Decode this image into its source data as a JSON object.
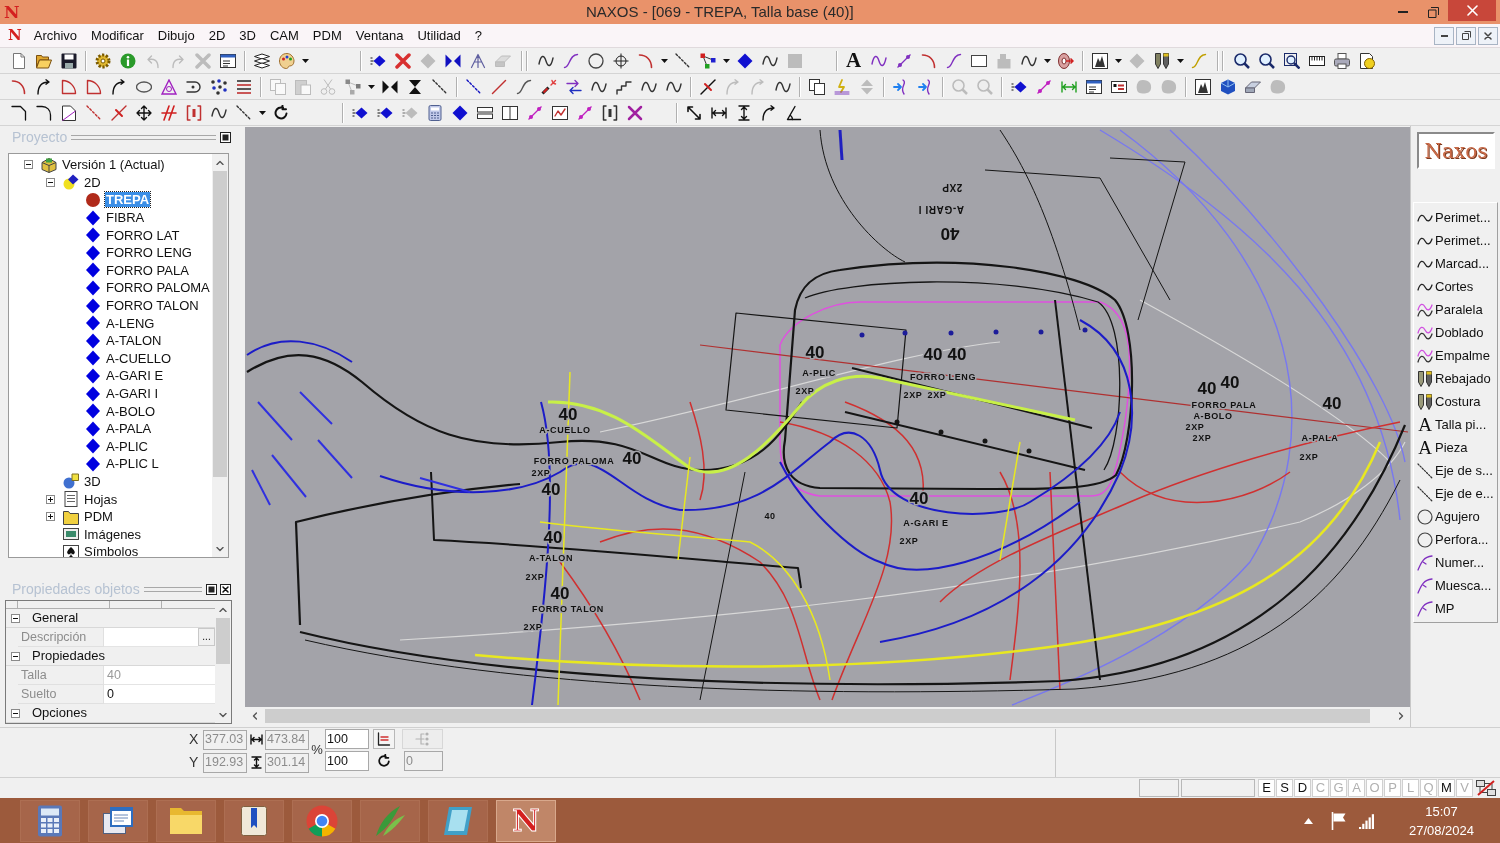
{
  "title_bar": {
    "logo": "N",
    "title": "NAXOS - [069 - TREPA, Talla base (40)]"
  },
  "menu_bar": {
    "logo": "N",
    "items": [
      "Archivo",
      "Modificar",
      "Dibujo",
      "2D",
      "3D",
      "CAM",
      "PDM",
      "Ventana",
      "Utilidad",
      "?"
    ]
  },
  "toolbar": {
    "text_tool": "A"
  },
  "project_panel": {
    "title": "Proyecto",
    "tree": [
      {
        "label": "Versión 1 (Actual)",
        "kind": "version",
        "expanded": true,
        "selected": false,
        "children": [
          {
            "label": "2D",
            "kind": "plane",
            "expanded": true,
            "selected": false,
            "children": [
              {
                "label": "TREPA",
                "kind": "piece",
                "selected": true
              },
              {
                "label": "FIBRA",
                "kind": "piece",
                "selected": false
              },
              {
                "label": "FORRO LAT",
                "kind": "piece",
                "selected": false
              },
              {
                "label": "FORRO LENG",
                "kind": "piece",
                "selected": false
              },
              {
                "label": "FORRO PALA",
                "kind": "piece",
                "selected": false
              },
              {
                "label": "FORRO PALOMA",
                "kind": "piece",
                "selected": false
              },
              {
                "label": "FORRO TALON",
                "kind": "piece",
                "selected": false
              },
              {
                "label": "A-LENG",
                "kind": "piece",
                "selected": false
              },
              {
                "label": "A-TALON",
                "kind": "piece",
                "selected": false
              },
              {
                "label": "A-CUELLO",
                "kind": "piece",
                "selected": false
              },
              {
                "label": "A-GARI E",
                "kind": "piece",
                "selected": false
              },
              {
                "label": "A-GARI I",
                "kind": "piece",
                "selected": false
              },
              {
                "label": "A-BOLO",
                "kind": "piece",
                "selected": false
              },
              {
                "label": "A-PALA",
                "kind": "piece",
                "selected": false
              },
              {
                "label": "A-PLIC",
                "kind": "piece",
                "selected": false
              },
              {
                "label": "A-PLIC L",
                "kind": "piece",
                "selected": false
              }
            ]
          },
          {
            "label": "3D",
            "kind": "solid",
            "selected": false
          },
          {
            "label": "Hojas",
            "kind": "sheets",
            "expanded": false,
            "selected": false
          },
          {
            "label": "PDM",
            "kind": "folder",
            "expanded": false,
            "selected": false
          },
          {
            "label": "Imágenes",
            "kind": "images",
            "selected": false
          },
          {
            "label": "Símbolos",
            "kind": "symbols",
            "selected": false
          }
        ]
      }
    ]
  },
  "properties_panel": {
    "title": "Propiedades objetos",
    "groups": [
      {
        "label": "General",
        "expanded": true,
        "rows": [
          {
            "label": "Descripción",
            "button": "..."
          }
        ]
      },
      {
        "label": "Propiedades",
        "expanded": true,
        "rows": [
          {
            "label": "Talla",
            "value": "40",
            "readonly": true
          },
          {
            "label": "Suelto",
            "value": "0",
            "readonly": false
          }
        ]
      },
      {
        "label": "Opciones",
        "expanded": true
      }
    ]
  },
  "drawing": {
    "labels": [
      {
        "text": "2XP",
        "kind": "flipped_text"
      },
      {
        "text": "A-GARI I",
        "kind": "flipped_text"
      },
      {
        "text": "40",
        "kind": "flipped_size"
      },
      {
        "text": "40",
        "kind": "size"
      },
      {
        "text": "A-PLIC",
        "kind": "text"
      },
      {
        "text": "2XP",
        "kind": "text"
      },
      {
        "text": "40",
        "kind": "size"
      },
      {
        "text": "40",
        "kind": "size"
      },
      {
        "text": "FORRO LENG",
        "kind": "text"
      },
      {
        "text": "2XP",
        "kind": "text"
      },
      {
        "text": "2XP",
        "kind": "text"
      },
      {
        "text": "40",
        "kind": "size"
      },
      {
        "text": "40",
        "kind": "size"
      },
      {
        "text": "FORRO PALA",
        "kind": "text"
      },
      {
        "text": "A-BOLO",
        "kind": "text"
      },
      {
        "text": "2XP",
        "kind": "text"
      },
      {
        "text": "2XP",
        "kind": "text"
      },
      {
        "text": "40",
        "kind": "size"
      },
      {
        "text": "A-PALA",
        "kind": "text"
      },
      {
        "text": "2XP",
        "kind": "text"
      },
      {
        "text": "40",
        "kind": "size"
      },
      {
        "text": "A-CUELLO",
        "kind": "text"
      },
      {
        "text": "FORRO PALOMA",
        "kind": "text"
      },
      {
        "text": "40",
        "kind": "size"
      },
      {
        "text": "2XP",
        "kind": "text"
      },
      {
        "text": "40",
        "kind": "size"
      },
      {
        "text": "40",
        "kind": "size"
      },
      {
        "text": "A-GARI E",
        "kind": "text"
      },
      {
        "text": "2XP",
        "kind": "text"
      },
      {
        "text": "40",
        "kind": "text"
      },
      {
        "text": "40",
        "kind": "size"
      },
      {
        "text": "A-TALON",
        "kind": "text"
      },
      {
        "text": "2XP",
        "kind": "text"
      },
      {
        "text": "40",
        "kind": "size"
      },
      {
        "text": "FORRO TALON",
        "kind": "text"
      },
      {
        "text": "2XP",
        "kind": "text"
      }
    ]
  },
  "right_panel": {
    "logo": "Naxos",
    "tools": [
      {
        "label": "Perimet...",
        "kind": "curve"
      },
      {
        "label": "Perimet...",
        "kind": "curve"
      },
      {
        "label": "Marcad...",
        "kind": "curve"
      },
      {
        "label": "Cortes",
        "kind": "curve"
      },
      {
        "label": "Paralela",
        "kind": "double_wave"
      },
      {
        "label": "Doblado",
        "kind": "double_wave"
      },
      {
        "label": "Empalme",
        "kind": "double_wave"
      },
      {
        "label": "Rebajado",
        "kind": "pencils"
      },
      {
        "label": "Costura",
        "kind": "pencils"
      },
      {
        "label": "Talla pi...",
        "kind": "text",
        "glyph": "A"
      },
      {
        "label": "Pieza",
        "kind": "text",
        "glyph": "A"
      },
      {
        "label": "Eje de s...",
        "kind": "axis"
      },
      {
        "label": "Eje de e...",
        "kind": "axis"
      },
      {
        "label": "Agujero",
        "kind": "circle"
      },
      {
        "label": "Perfora...",
        "kind": "circle"
      },
      {
        "label": "Numer...",
        "kind": "notch"
      },
      {
        "label": "Muesca...",
        "kind": "notch"
      },
      {
        "label": "MP",
        "kind": "notch"
      }
    ]
  },
  "coordinates": {
    "percent": "%",
    "rows": [
      {
        "axis": "X",
        "position": {
          "value": "377.03",
          "disabled": true
        },
        "size": {
          "value": "473.84",
          "disabled": true
        },
        "scale": {
          "value": "100",
          "disabled": false
        },
        "extras": [
          {
            "kind": "ruler_button",
            "disabled": false
          },
          {
            "kind": "branch_button",
            "disabled": true
          }
        ]
      },
      {
        "axis": "Y",
        "position": {
          "value": "192.93",
          "disabled": true
        },
        "size": {
          "value": "301.14",
          "disabled": true
        },
        "scale": {
          "value": "100",
          "disabled": false
        },
        "extras": [
          {
            "kind": "rotate_label"
          },
          {
            "kind": "angle_field",
            "value": "0",
            "disabled": true
          }
        ]
      }
    ]
  },
  "status_bar": {
    "indicators": [
      {
        "label": "E",
        "on": true
      },
      {
        "label": "S",
        "on": true
      },
      {
        "label": "D",
        "on": true
      },
      {
        "label": "C",
        "on": false
      },
      {
        "label": "G",
        "on": false
      },
      {
        "label": "A",
        "on": false
      },
      {
        "label": "O",
        "on": false
      },
      {
        "label": "P",
        "on": false
      },
      {
        "label": "L",
        "on": false
      },
      {
        "label": "Q",
        "on": false
      },
      {
        "label": "M",
        "on": true
      },
      {
        "label": "V",
        "on": false
      }
    ]
  },
  "taskbar": {
    "apps": [
      {
        "kind": "calculator",
        "selected": false
      },
      {
        "kind": "window",
        "selected": false
      },
      {
        "kind": "folder",
        "selected": false
      },
      {
        "kind": "card",
        "selected": false
      },
      {
        "kind": "ring",
        "selected": false
      },
      {
        "kind": "leaf",
        "selected": false
      },
      {
        "kind": "notebook",
        "selected": false
      },
      {
        "kind": "logo",
        "glyph": "N",
        "selected": true
      }
    ],
    "time": "15:07",
    "date": "27/08/2024"
  }
}
